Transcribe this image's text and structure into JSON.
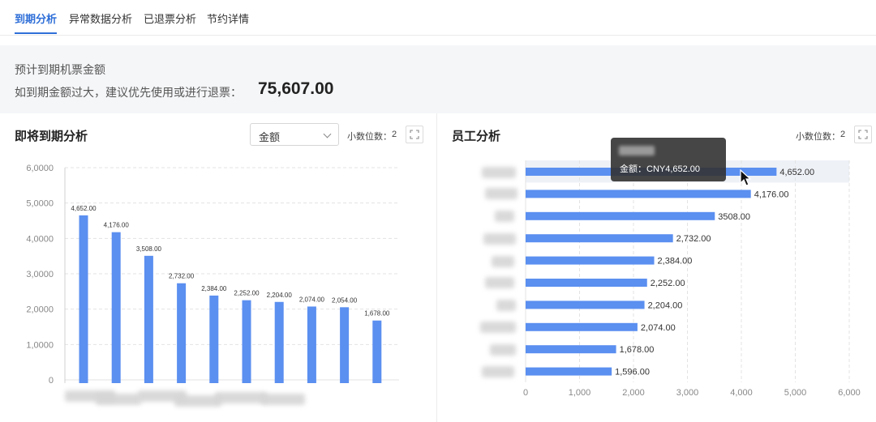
{
  "tabs": [
    {
      "label": "到期分析",
      "active": true
    },
    {
      "label": "异常数据分析",
      "active": false
    },
    {
      "label": "已退票分析",
      "active": false
    },
    {
      "label": "节约详情",
      "active": false
    }
  ],
  "summary": {
    "title": "预计到期机票金额",
    "hint": "如到期金额过大，建议优先使用或进行退票：",
    "amount": "75,607.00"
  },
  "left_panel": {
    "title": "即将到期分析",
    "select_value": "金额",
    "decimal_label": "小数位数：",
    "decimal_value": "2"
  },
  "right_panel": {
    "title": "员工分析",
    "decimal_label": "小数位数：",
    "decimal_value": "2"
  },
  "tooltip": {
    "line": "金额：CNY4,652.00"
  },
  "colors": {
    "accent": "#2f6fd8",
    "bar": "#5b8ff0"
  },
  "chart_data": [
    {
      "type": "bar",
      "orientation": "vertical",
      "categories": [
        "",
        "",
        "",
        "",
        "",
        "",
        "",
        "",
        "",
        ""
      ],
      "values": [
        4652,
        4176,
        3508,
        2732,
        2384,
        2252,
        2204,
        2074,
        2054,
        1678
      ],
      "data_labels": [
        "4,652.00",
        "4,176.00",
        "3,508.00",
        "2,732.00",
        "2,384.00",
        "2,252.00",
        "2,204.00",
        "2,074.00",
        "2,054.00",
        "1,678.00"
      ],
      "ytick_labels": [
        "0",
        "1,0000",
        "2,0000",
        "3,0000",
        "4,0000",
        "5,0000",
        "6,0000"
      ],
      "ylim": [
        0,
        6000
      ],
      "grid": true
    },
    {
      "type": "bar",
      "orientation": "horizontal",
      "categories": [
        "",
        "",
        "",
        "",
        "",
        "",
        "",
        "",
        "",
        ""
      ],
      "values": [
        4652,
        4176,
        3508,
        2732,
        2384,
        2252,
        2204,
        2074,
        1678,
        1596
      ],
      "data_labels": [
        "4,652.00",
        "4,176.00",
        "3508.00",
        "2,732.00",
        "2,384.00",
        "2,252.00",
        "2,204.00",
        "2,074.00",
        "1,678.00",
        "1,596.00"
      ],
      "xtick_labels": [
        "0",
        "1,000",
        "2,000",
        "3,000",
        "4,000",
        "5,000",
        "6,000"
      ],
      "xlim": [
        0,
        6000
      ],
      "grid": true,
      "highlighted_index": 0
    }
  ]
}
